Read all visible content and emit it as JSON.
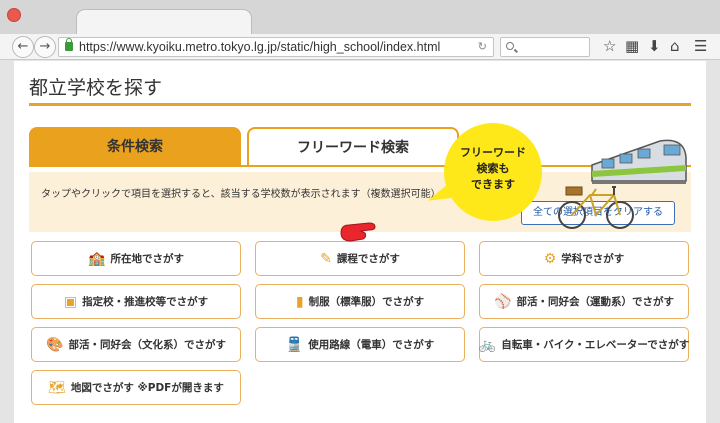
{
  "browser": {
    "url": "https://www.kyoiku.metro.tokyo.lg.jp/static/high_school/index.html"
  },
  "page": {
    "title": "都立学校を探す",
    "tabs": {
      "condition": "条件検索",
      "freeword": "フリーワード検索"
    },
    "instruction": "タップやクリックで項目を選択すると、該当する学校数が表示されます（複数選択可能）。",
    "clear_button": "全ての選択項目をクリアする",
    "bubble": "フリーワード\n検索も\nできます",
    "search_buttons": [
      {
        "label": "所在地でさがす",
        "icon": "school-building-icon"
      },
      {
        "label": "課程でさがす",
        "icon": "pencil-icon"
      },
      {
        "label": "学科でさがす",
        "icon": "gear-icon"
      },
      {
        "label": "指定校・推進校等でさがす",
        "icon": "document-icon"
      },
      {
        "label": "制服（標準服）でさがす",
        "icon": "uniform-icon"
      },
      {
        "label": "部活・同好会（運動系）でさがす",
        "icon": "baseball-bat-icon"
      },
      {
        "label": "部活・同好会（文化系）でさがす",
        "icon": "palette-icon"
      },
      {
        "label": "使用路線（電車）でさがす",
        "icon": "train-icon"
      },
      {
        "label": "自転車・バイク・エレベーターでさがす",
        "icon": "bicycle-icon"
      },
      {
        "label": "地図でさがす ※PDFが開きます",
        "icon": "map-icon"
      }
    ]
  }
}
